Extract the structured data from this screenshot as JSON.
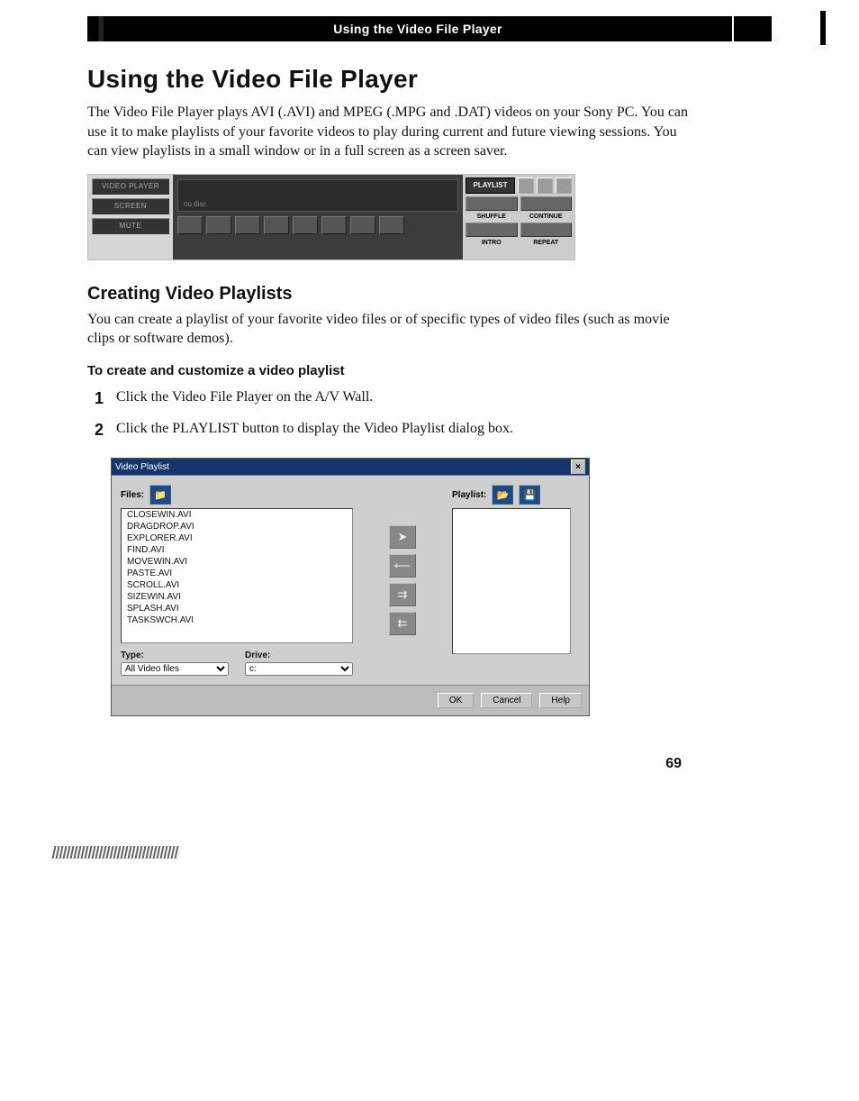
{
  "header": {
    "title": "Using the Video File Player"
  },
  "h1": "Using the Video File Player",
  "intro": "The Video File Player plays AVI (.AVI) and MPEG (.MPG and .DAT) videos on your Sony PC. You can use it to make playlists of your favorite videos to play during current and future viewing sessions. You can view playlists in a small window or in a full screen as a screen saver.",
  "section_h2": "Creating Video Playlists",
  "section_p": "You can create a playlist of your favorite video files or of specific types of video files (such as movie clips or software demos).",
  "step_h3": "To create and customize a video playlist",
  "steps": [
    {
      "n": "1",
      "t": "Click the Video File Player on the A/V Wall."
    },
    {
      "n": "2",
      "t": "Click the PLAYLIST button to display the Video Playlist dialog box."
    }
  ],
  "page_number": "69",
  "fig1": {
    "left": {
      "l1": "VIDEO PLAYER",
      "l2": "SCREEN",
      "l3": "MUTE"
    },
    "mid": {
      "placeholder": "no disc"
    },
    "right": {
      "playlist_label": "PLAYLIST",
      "row2": {
        "a": "SHUFFLE",
        "b": "CONTINUE"
      },
      "row3": {
        "a": "INTRO",
        "b": "REPEAT"
      }
    }
  },
  "fig2": {
    "title": "Video Playlist",
    "close": "×",
    "files_label": "Files:",
    "playlist_label": "Playlist:",
    "filelist": [
      "CLOSEWIN.AVI",
      "DRAGDROP.AVI",
      "EXPLORER.AVI",
      "FIND.AVI",
      "MOVEWIN.AVI",
      "PASTE.AVI",
      "SCROLL.AVI",
      "SIZEWIN.AVI",
      "SPLASH.AVI",
      "TASKSWCH.AVI"
    ],
    "type_label": "Type:",
    "drive_label": "Drive:",
    "type_value": "All Video files",
    "drive_value": "c:",
    "buttons": {
      "ok": "OK",
      "cancel": "Cancel",
      "help": "Help"
    }
  }
}
